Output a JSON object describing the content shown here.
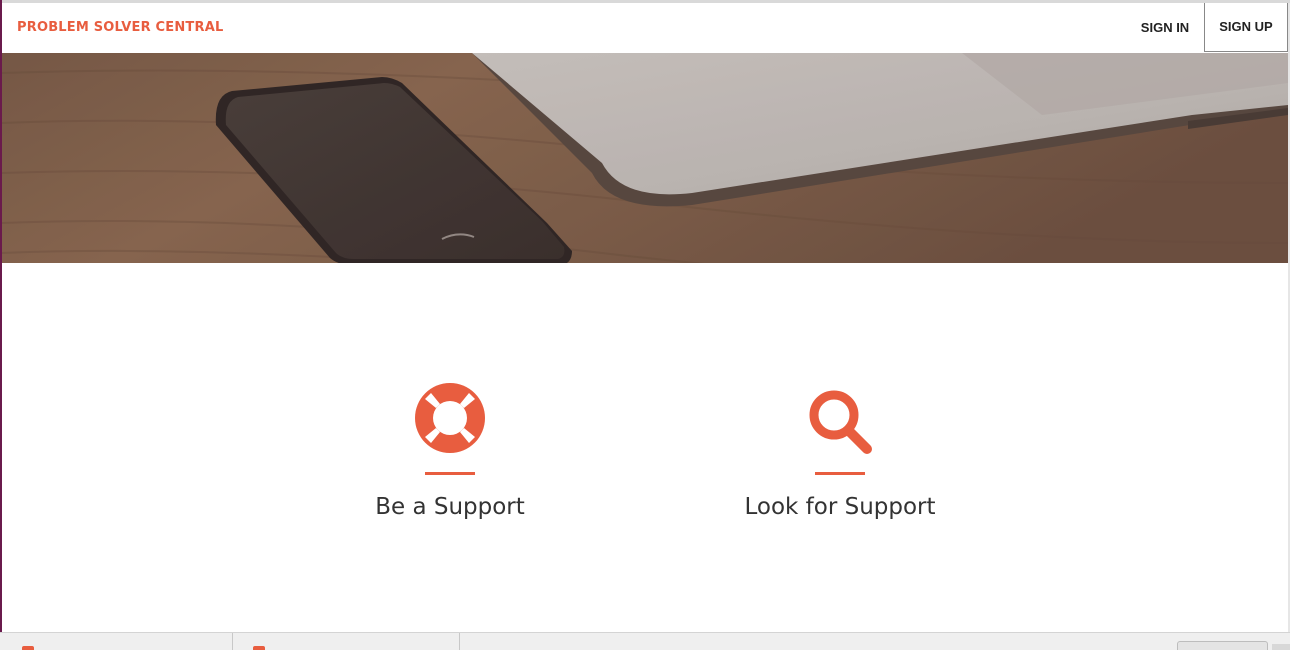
{
  "navbar": {
    "brand": "PROBLEM SOLVER CENTRAL",
    "sign_in": "SIGN IN",
    "sign_up": "SIGN UP"
  },
  "hero": {
    "image": "desk-phone-laptop-photo"
  },
  "features": [
    {
      "label": "Be a Support",
      "icon": "lifebuoy-icon"
    },
    {
      "label": "Look for Support",
      "icon": "search-icon"
    }
  ],
  "colors": {
    "accent": "#e85d3f",
    "text": "#333333",
    "nav_text": "#222222"
  }
}
